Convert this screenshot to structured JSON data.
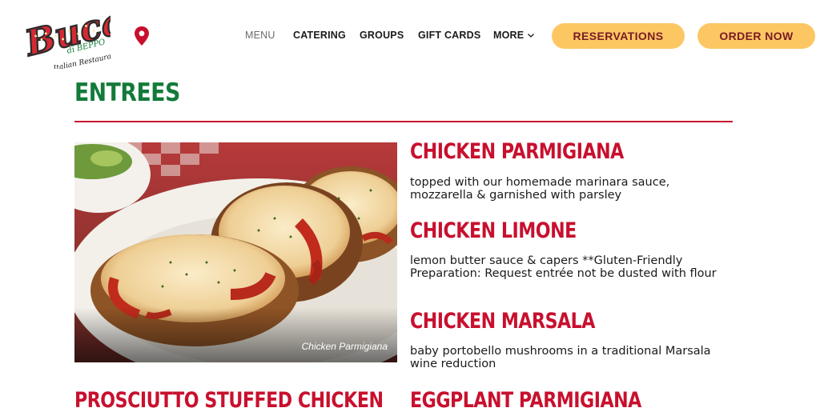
{
  "brand": {
    "name": "Buca",
    "sub": "di BEPPO",
    "tagline": "Italian Restaurant"
  },
  "nav": {
    "menu": "MENU",
    "catering": "CATERING",
    "groups": "GROUPS",
    "gift_cards": "GIFT CARDS",
    "more": "MORE",
    "reservations": "RESERVATIONS",
    "order_now": "ORDER NOW"
  },
  "section": {
    "title": "ENTREES"
  },
  "photo": {
    "caption": "Chicken Parmigiana"
  },
  "items": [
    {
      "name": "CHICKEN PARMIGIANA",
      "desc": "topped with our homemade marinara sauce, mozzarella & garnished with parsley"
    },
    {
      "name": "CHICKEN LIMONE",
      "desc": "lemon butter sauce & capers **Gluten-Friendly Preparation: Request entrée not be dusted with flour"
    },
    {
      "name": "CHICKEN MARSALA",
      "desc": "baby portobello mushrooms in a traditional Marsala wine reduction"
    },
    {
      "name": "PROSCIUTTO STUFFED CHICKEN",
      "desc": ""
    },
    {
      "name": "EGGPLANT PARMIGIANA",
      "desc": ""
    }
  ],
  "colors": {
    "accent_red": "#c8102e",
    "entrees_green": "#137a3a",
    "button_yellow": "#fcc762",
    "button_text": "#7a1a24"
  }
}
